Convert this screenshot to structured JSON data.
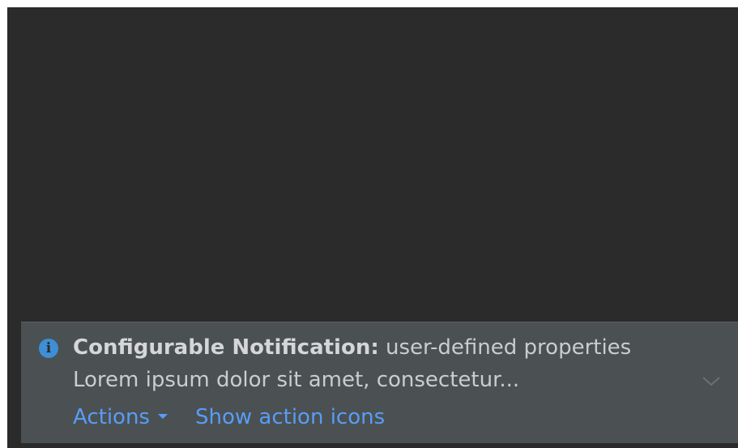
{
  "notification": {
    "icon": "info-icon",
    "title_strong": "Configurable Notification:",
    "title_rest": " user-defined properties",
    "body": "Lorem ipsum dolor sit amet, consectetur...",
    "expand_icon": "chevron-down-icon",
    "actions_label": "Actions",
    "show_icons_label": "Show action icons"
  },
  "colors": {
    "stage_background": "#2b2b2b",
    "notification_background": "#4b5052",
    "link": "#589df6",
    "info_icon": "#3d8fd6",
    "text": "#c9cdcf"
  }
}
